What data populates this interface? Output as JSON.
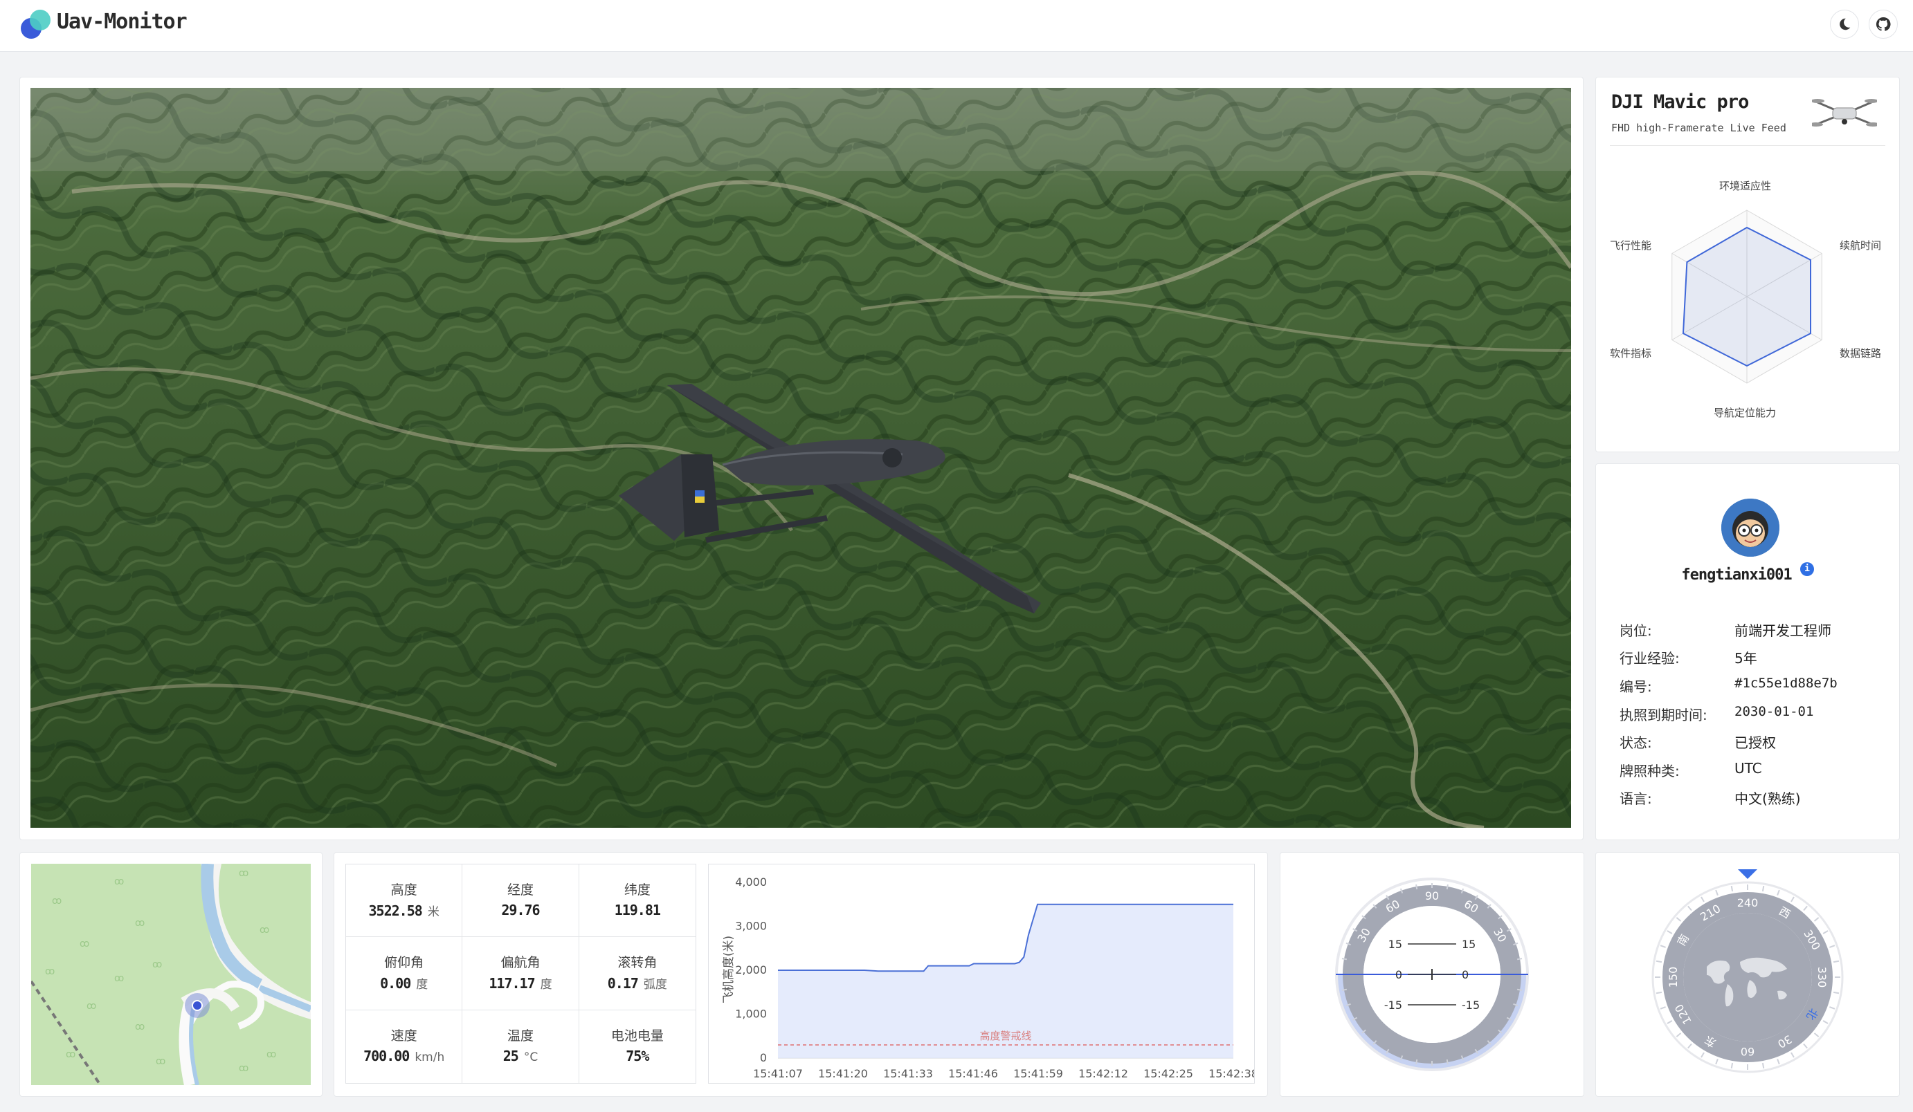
{
  "app": {
    "title": "Uav-Monitor",
    "accent": "#3a5bd9"
  },
  "header": {
    "theme_icon": "moon-icon",
    "repo_icon": "github-icon"
  },
  "drone": {
    "name": "DJI Mavic pro",
    "subtitle": "FHD high-Framerate Live Feed",
    "radar": {
      "labels": [
        "环境适应性",
        "续航时间",
        "数据链路",
        "导航定位能力",
        "软件指标",
        "飞行性能"
      ],
      "values": [
        0.8,
        0.85,
        0.85,
        0.8,
        0.85,
        0.8
      ]
    }
  },
  "profile": {
    "username": "fengtianxi001",
    "rows": [
      {
        "k": "岗位:",
        "v": "前端开发工程师"
      },
      {
        "k": "行业经验:",
        "v": "5年"
      },
      {
        "k": "编号:",
        "v": "#1c55e1d88e7b"
      },
      {
        "k": "执照到期时间:",
        "v": "2030-01-01"
      },
      {
        "k": "状态:",
        "v": "已授权"
      },
      {
        "k": "牌照种类:",
        "v": "UTC"
      },
      {
        "k": "语言:",
        "v": "中文(熟练)"
      }
    ]
  },
  "telemetry": [
    {
      "label": "高度",
      "value": "3522.58",
      "unit": "米"
    },
    {
      "label": "经度",
      "value": "29.76",
      "unit": ""
    },
    {
      "label": "纬度",
      "value": "119.81",
      "unit": ""
    },
    {
      "label": "俯仰角",
      "value": "0.00",
      "unit": "度"
    },
    {
      "label": "偏航角",
      "value": "117.17",
      "unit": "度"
    },
    {
      "label": "滚转角",
      "value": "0.17",
      "unit": "弧度"
    },
    {
      "label": "速度",
      "value": "700.00",
      "unit": "km/h"
    },
    {
      "label": "温度",
      "value": "25",
      "unit": "°C"
    },
    {
      "label": "电池电量",
      "value": "75%",
      "unit": ""
    }
  ],
  "chart_data": {
    "type": "area",
    "ylabel": "飞机高度(米)",
    "ylim": [
      0,
      4000
    ],
    "yticks": [
      "0",
      "1,000",
      "2,000",
      "3,000",
      "4,000"
    ],
    "categories": [
      "15:41:07",
      "15:41:20",
      "15:41:33",
      "15:41:46",
      "15:41:59",
      "15:42:12",
      "15:42:25",
      "15:42:38"
    ],
    "series": [
      {
        "x": [
          0,
          0.19,
          0.22,
          0.32,
          0.33,
          0.42,
          0.43,
          0.52,
          0.53,
          0.54,
          0.55,
          0.57,
          0.59,
          1.0
        ],
        "y": [
          2000,
          2000,
          1980,
          1980,
          2100,
          2100,
          2150,
          2150,
          2180,
          2300,
          2800,
          3500,
          3500,
          3500
        ]
      }
    ],
    "threshold": {
      "label": "高度警戒线",
      "value": 300
    },
    "grid": false,
    "color": "#4a6fd6"
  },
  "attitude": {
    "pitch_labels": [
      "15",
      "15",
      "0",
      "0",
      "-15",
      "-15"
    ],
    "roll_labels": [
      "30",
      "60",
      "90",
      "60",
      "30"
    ]
  },
  "compass": {
    "labels": [
      "240",
      "西",
      "300",
      "330",
      "北",
      "30",
      "60",
      "东",
      "120",
      "150",
      "南",
      "210"
    ]
  }
}
